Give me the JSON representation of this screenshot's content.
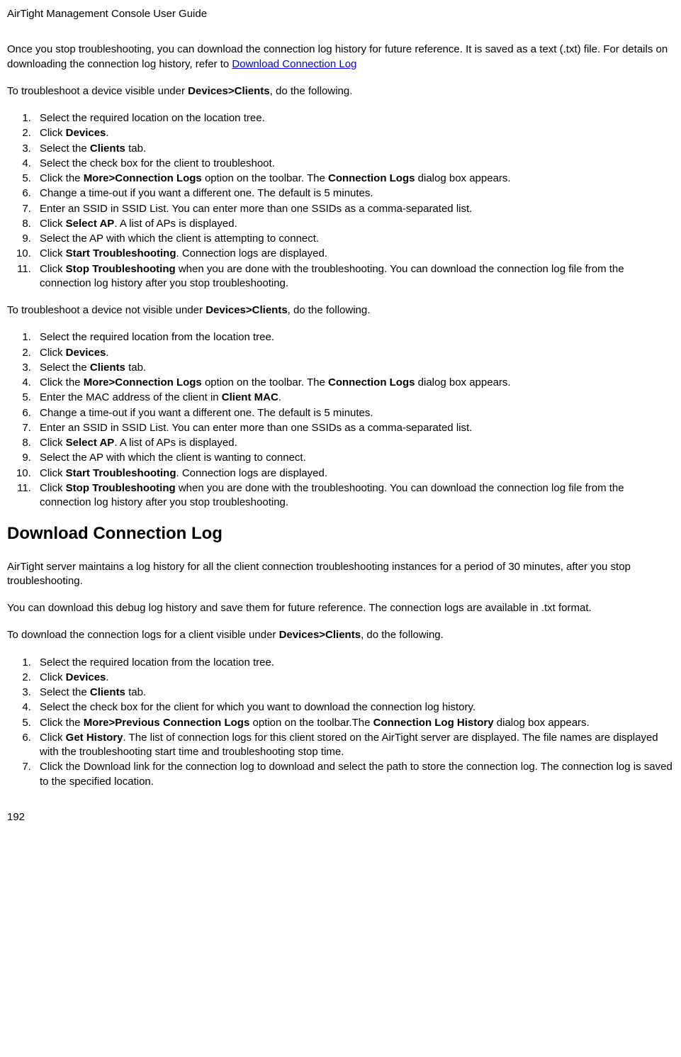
{
  "header": "AirTight Management Console User Guide",
  "p1_a": "Once you stop troubleshooting, you can download the connection log history for future reference. It is saved as a text (.txt) file. For details on downloading the connection log history, refer to ",
  "p1_link": "Download Connection Log",
  "p2_a": "To troubleshoot a device visible under ",
  "p2_b": "Devices>Clients",
  "p2_c": ", do the following.",
  "list1": {
    "i1": "Select the required location on the location tree.",
    "i2a": "Click ",
    "i2b": "Devices",
    "i2c": ".",
    "i3a": "Select the ",
    "i3b": "Clients",
    "i3c": " tab.",
    "i4": "Select the check box for the client to troubleshoot.",
    "i5a": "Click the ",
    "i5b": "More>Connection Logs",
    "i5c": " option on the toolbar. The ",
    "i5d": "Connection Logs",
    "i5e": " dialog box appears.",
    "i6": "Change a time-out if you want a different one. The default is 5 minutes.",
    "i7": "Enter an SSID in SSID List. You can enter more than one SSIDs as a comma-separated list.",
    "i8a": "Click ",
    "i8b": "Select AP",
    "i8c": ". A list of APs is displayed.",
    "i9": "Select the AP with which the client is attempting to connect.",
    "i10a": "Click ",
    "i10b": "Start Troubleshooting",
    "i10c": ". Connection logs are  displayed.",
    "i11a": "Click ",
    "i11b": "Stop Troubleshooting",
    "i11c": " when you are done with the troubleshooting. You can download the connection log file from the connection log history after you stop troubleshooting."
  },
  "p3_a": "To troubleshoot a device not visible under ",
  "p3_b": "Devices>Clients",
  "p3_c": ", do the following.",
  "list2": {
    "i1": "Select the required location from the location tree.",
    "i2a": "Click ",
    "i2b": "Devices",
    "i2c": ".",
    "i3a": "Select the ",
    "i3b": "Clients",
    "i3c": " tab.",
    "i4a": "Click the ",
    "i4b": "More>Connection Logs",
    "i4c": " option on the toolbar. The ",
    "i4d": "Connection Logs",
    "i4e": " dialog box appears.",
    "i5a": "Enter the MAC address of the client in ",
    "i5b": "Client MAC",
    "i5c": ".",
    "i6": "Change a time-out if you want a different one. The default is 5 minutes.",
    "i7": "Enter an SSID in SSID List. You can enter more than one SSIDs as a comma-separated list.",
    "i8a": "Click ",
    "i8b": "Select AP",
    "i8c": ". A list of APs is displayed.",
    "i9": "Select the AP with which the client is wanting to connect.",
    "i10a": "Click ",
    "i10b": "Start Troubleshooting",
    "i10c": ". Connection logs are  displayed.",
    "i11a": "Click ",
    "i11b": "Stop Troubleshooting",
    "i11c": " when you are done with the troubleshooting. You can download the connection log file from the connection log history after you stop troubleshooting."
  },
  "h2": "Download Connection Log",
  "p4": "AirTight server maintains a log history for all the client connection troubleshooting instances for a period of 30 minutes, after you stop troubleshooting.",
  "p5": "You can download this debug log history and save them for future reference. The connection logs are available in .txt format.",
  "p6_a": "To download the connection logs for a client visible under ",
  "p6_b": "Devices>Clients",
  "p6_c": ", do the following.",
  "list3": {
    "i1": "Select the required location from the location tree.",
    "i2a": "Click ",
    "i2b": "Devices",
    "i2c": ".",
    "i3a": "Select the ",
    "i3b": "Clients",
    "i3c": " tab.",
    "i4": "Select the check box for the client for which you want to download the connection log history.",
    "i5a": "Click the ",
    "i5b": "More>Previous Connection Logs",
    "i5c": " option on the toolbar.The ",
    "i5d": "Connection Log History",
    "i5e": " dialog box appears.",
    "i6a": "Click ",
    "i6b": "Get History",
    "i6c": ". The list of connection logs for this client stored on the AirTight server are displayed. The file names are displayed with the troubleshooting start time and troubleshooting stop time.",
    "i7": "Click the Download link for the connection log to download and select the path to store the connection log. The connection log is saved to the specified location."
  },
  "pagenum": "192"
}
